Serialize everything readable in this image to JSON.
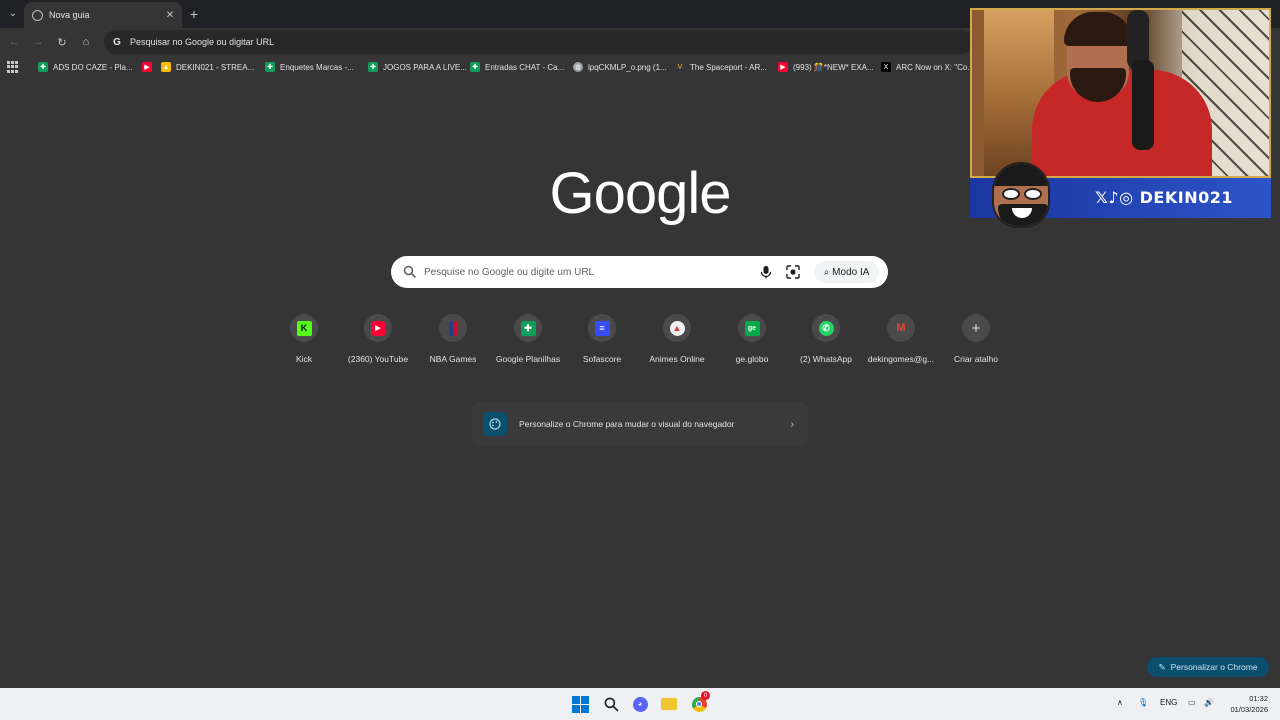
{
  "tabstrip": {
    "tab_title": "Nova guia",
    "new_tab": "+"
  },
  "toolbar": {
    "omnibox_text": "Pesquisar no Google ou digitar URL"
  },
  "bookmarks": [
    {
      "label": "ADS DO CAZE - Pla...",
      "icon": "sheets-icon",
      "color": "#0f9d58"
    },
    {
      "label": "DEKIN021 - STREA...",
      "icon": "drive-icon",
      "color": "#fbbc04"
    },
    {
      "label": "Enquetes Marcas -...",
      "icon": "sheets-icon",
      "color": "#0f9d58"
    },
    {
      "label": "JOGOS PARA A LIVE...",
      "icon": "sheets-icon",
      "color": "#0f9d58"
    },
    {
      "label": "Entradas CHAT - Ca...",
      "icon": "sheets-icon",
      "color": "#0f9d58"
    },
    {
      "label": "lpqCKMLP_o.png (1...",
      "icon": "globe-icon",
      "color": "#9aa0a6"
    },
    {
      "label": "The Spaceport - AR...",
      "icon": "spaceport-icon",
      "color": "#e6c229"
    },
    {
      "label": "(993) 🎊*NEW* EXA...",
      "icon": "youtube-icon",
      "color": "#ff0033"
    },
    {
      "label": "ARC Now on X: \"Co...",
      "icon": "x-icon",
      "color": "#000000"
    }
  ],
  "logo": "Google",
  "search": {
    "placeholder": "Pesquise no Google ou digite um URL",
    "ai_mode_label": "Modo IA"
  },
  "shortcuts": [
    {
      "label": "Kick",
      "icon": "kick-icon",
      "color": "#53fc18",
      "glyph": "K"
    },
    {
      "label": "(2360) YouTube",
      "icon": "youtube-icon",
      "color": "#ff0033",
      "glyph": "▶"
    },
    {
      "label": "NBA Games",
      "icon": "nba-icon",
      "color": "#1d428a",
      "glyph": "▮"
    },
    {
      "label": "Google Planilhas",
      "icon": "sheets-icon",
      "color": "#0f9d58",
      "glyph": "✚"
    },
    {
      "label": "Sofascore",
      "icon": "sofascore-icon",
      "color": "#374df5",
      "glyph": "≡"
    },
    {
      "label": "Animes Online",
      "icon": "animes-icon",
      "color": "#d33a3a",
      "glyph": "▲"
    },
    {
      "label": "ge.globo",
      "icon": "ge-globo-icon",
      "color": "#06aa48",
      "glyph": "ge"
    },
    {
      "label": "(2) WhatsApp",
      "icon": "whatsapp-icon",
      "color": "#25d366",
      "glyph": "✆"
    },
    {
      "label": "dekingomes@g...",
      "icon": "gmail-icon",
      "color": "#ea4335",
      "glyph": "M"
    },
    {
      "label": "Criar atalho",
      "icon": "plus-icon",
      "color": "#e3e3e3",
      "glyph": "+"
    }
  ],
  "customize_card": {
    "text": "Personalize o Chrome para mudar o visual do navegador"
  },
  "customize_button": {
    "label": "Personalizar o Chrome"
  },
  "stream_overlay": {
    "handle": "DEKIN021",
    "social_icons": "𝕏♪◎"
  },
  "taskbar": {
    "language": "ENG",
    "time": "01:32",
    "date": "01/03/2026",
    "chrome_badge": "0"
  }
}
